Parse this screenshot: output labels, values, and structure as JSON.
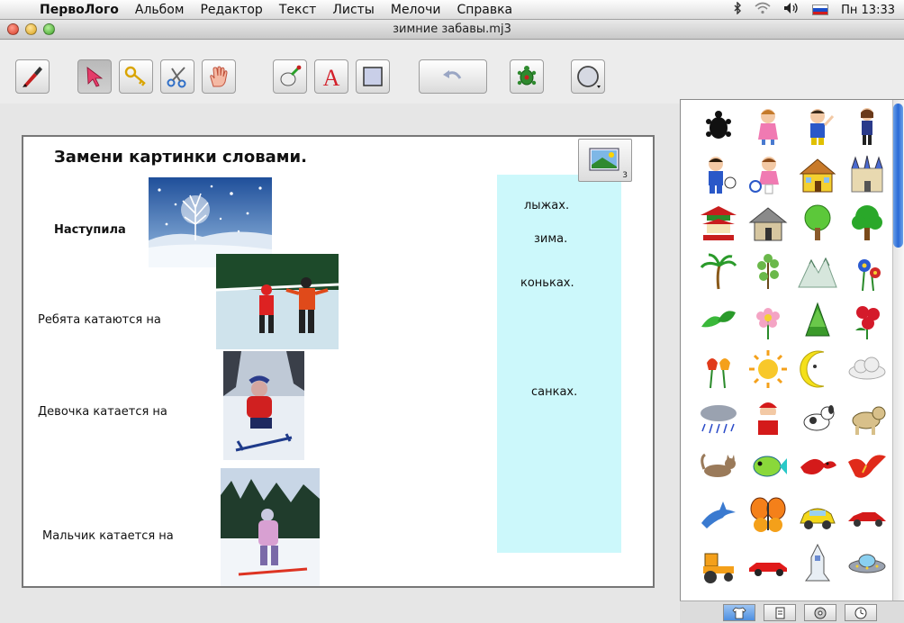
{
  "menubar": {
    "app_name": "ПервоЛого",
    "items": [
      "Альбом",
      "Редактор",
      "Текст",
      "Листы",
      "Мелочи",
      "Справка"
    ],
    "clock": "Пн 13:33"
  },
  "window": {
    "title": "зимние забавы.mj3"
  },
  "toolbar": {
    "tools": [
      "brush-tool",
      "arrow-select-tool",
      "key-tool",
      "scissors-tool",
      "hand-tool",
      "turtle-pen-tool",
      "text-tool",
      "rectangle-tool",
      "undo",
      "new-turtle",
      "color-picker"
    ]
  },
  "page": {
    "title": "Замени картинки словами.",
    "sentences": [
      "Наступила",
      "Ребята катаются на",
      "Девочка катается на",
      "Мальчик катается на"
    ],
    "answers": [
      "лыжах.",
      "зима.",
      "коньках.",
      "санках."
    ],
    "image_button_count": "3"
  },
  "palette": {
    "shapes": [
      "turtle",
      "girl",
      "boy-waving",
      "schoolgirl",
      "boy-tennis",
      "girl-tennis",
      "house",
      "castle",
      "pagoda",
      "hut",
      "tree-round",
      "tree-green",
      "palm-tree",
      "small-tree",
      "mountain",
      "blue-flowers",
      "leaves",
      "pink-flower",
      "fir-bush",
      "red-flower",
      "tulips",
      "sun",
      "crescent-moon",
      "cloud",
      "rain-cloud",
      "santa",
      "dog-white",
      "dog-tan",
      "cat",
      "fish",
      "red-bird",
      "red-bird-2",
      "dolphin",
      "butterfly",
      "yellow-car",
      "red-car",
      "tractor",
      "race-car",
      "space-shuttle",
      "ufo"
    ]
  },
  "bottom_tabs": [
    "shapes-tab",
    "pages-tab",
    "sounds-tab",
    "music-tab"
  ]
}
